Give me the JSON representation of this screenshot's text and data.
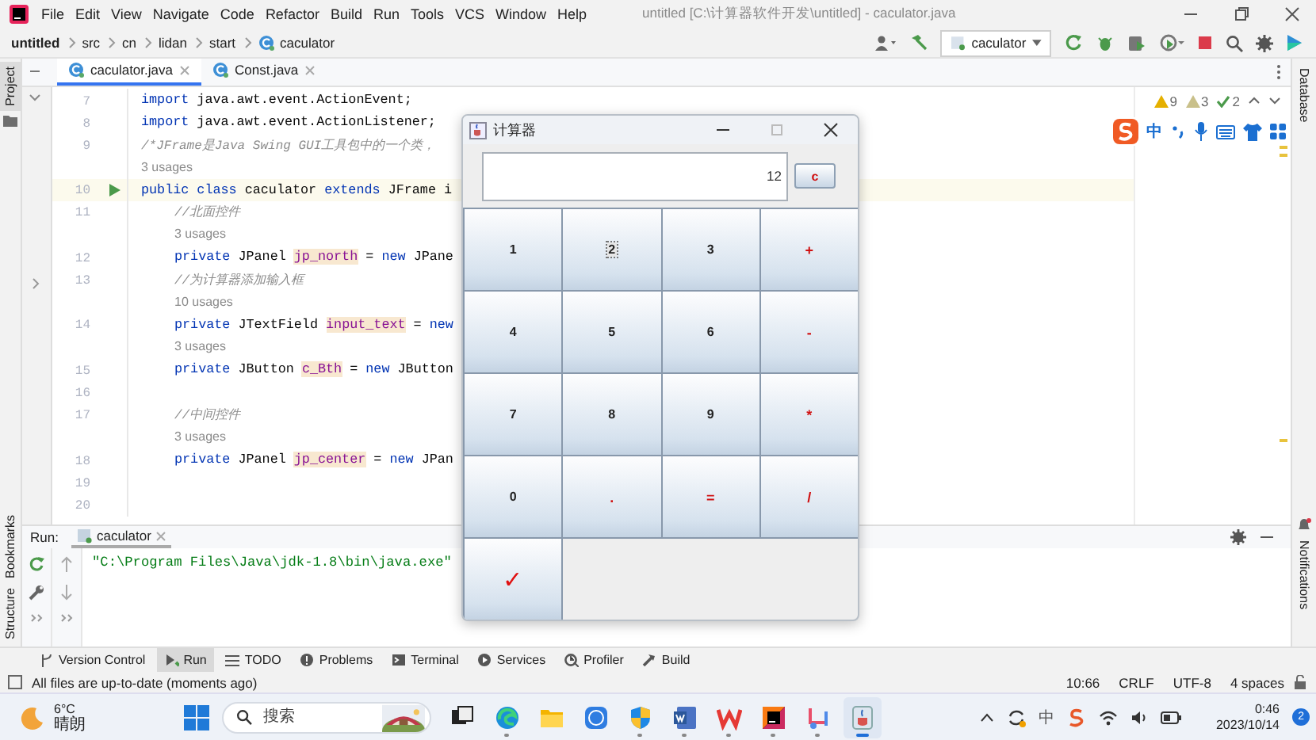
{
  "window": {
    "title": "untitled [C:\\计算器软件开发\\untitled] - caculator.java"
  },
  "menu": [
    "File",
    "Edit",
    "View",
    "Navigate",
    "Code",
    "Refactor",
    "Build",
    "Run",
    "Tools",
    "VCS",
    "Window",
    "Help"
  ],
  "breadcrumb": [
    "untitled",
    "src",
    "cn",
    "lidan",
    "start",
    "caculator"
  ],
  "run_config": "caculator",
  "side_left": {
    "top": "Project",
    "bottom": [
      "Bookmarks",
      "Structure"
    ]
  },
  "side_right": [
    "Database",
    "Notifications"
  ],
  "editor_tabs": [
    {
      "label": "caculator.java",
      "selected": true
    },
    {
      "label": "Const.java",
      "selected": false
    }
  ],
  "inspections": [
    {
      "kind": "warning",
      "count": "9"
    },
    {
      "kind": "weak",
      "count": "3"
    },
    {
      "kind": "typo",
      "count": "2"
    }
  ],
  "ime": {
    "mode": "中"
  },
  "code_lines": [
    {
      "number": "7",
      "segments": [
        {
          "kind": "kw",
          "text": "import"
        },
        {
          "kind": "plain",
          "text": " java.awt.event.ActionEvent;"
        }
      ]
    },
    {
      "number": "8",
      "segments": [
        {
          "kind": "kw",
          "text": "import"
        },
        {
          "kind": "plain",
          "text": " java.awt.event.ActionListener;"
        }
      ]
    },
    {
      "number": "9",
      "segments": [
        {
          "kind": "comment",
          "text": "/*JFrame是Java Swing GUI工具包中的一个类，"
        }
      ]
    },
    {
      "segments": [
        {
          "kind": "hint",
          "text": "3 usages"
        }
      ]
    },
    {
      "number": "10",
      "current": true,
      "runnable": true,
      "segments": [
        {
          "kind": "kw",
          "text": "public class "
        },
        {
          "kind": "plain",
          "text": "caculator "
        },
        {
          "kind": "kw",
          "text": "extends "
        },
        {
          "kind": "plain",
          "text": "JFrame i"
        }
      ]
    },
    {
      "number": "11",
      "indented": true,
      "segments": [
        {
          "kind": "comment",
          "text": "//北面控件"
        }
      ]
    },
    {
      "indented": true,
      "segments": [
        {
          "kind": "hint",
          "text": "3 usages"
        }
      ]
    },
    {
      "number": "12",
      "indented": true,
      "segments": [
        {
          "kind": "kw",
          "text": "private "
        },
        {
          "kind": "plain",
          "text": "JPanel "
        },
        {
          "kind": "field",
          "text": "jp_north"
        },
        {
          "kind": "plain",
          "text": " = "
        },
        {
          "kind": "kw",
          "text": "new "
        },
        {
          "kind": "plain",
          "text": "JPane"
        }
      ]
    },
    {
      "number": "13",
      "indented": true,
      "segments": [
        {
          "kind": "comment",
          "text": "//为计算器添加输入框"
        }
      ]
    },
    {
      "indented": true,
      "segments": [
        {
          "kind": "hint",
          "text": "10 usages"
        }
      ]
    },
    {
      "number": "14",
      "indented": true,
      "segments": [
        {
          "kind": "kw",
          "text": "private "
        },
        {
          "kind": "plain",
          "text": "JTextField "
        },
        {
          "kind": "field",
          "text": "input_text"
        },
        {
          "kind": "plain",
          "text": " = "
        },
        {
          "kind": "kw",
          "text": "new"
        }
      ]
    },
    {
      "indented": true,
      "segments": [
        {
          "kind": "hint",
          "text": "3 usages"
        }
      ]
    },
    {
      "number": "15",
      "indented": true,
      "segments": [
        {
          "kind": "kw",
          "text": "private "
        },
        {
          "kind": "plain",
          "text": "JButton "
        },
        {
          "kind": "field",
          "text": "c_Bth"
        },
        {
          "kind": "plain",
          "text": " = "
        },
        {
          "kind": "kw",
          "text": "new "
        },
        {
          "kind": "plain",
          "text": "JButton"
        }
      ]
    },
    {
      "number": "16"
    },
    {
      "number": "17",
      "indented": true,
      "segments": [
        {
          "kind": "comment",
          "text": "//中间控件"
        }
      ]
    },
    {
      "indented": true,
      "segments": [
        {
          "kind": "hint",
          "text": "3 usages"
        }
      ]
    },
    {
      "number": "18",
      "indented": true,
      "segments": [
        {
          "kind": "kw",
          "text": "private "
        },
        {
          "kind": "plain",
          "text": "JPanel "
        },
        {
          "kind": "field",
          "text": "jp_center"
        },
        {
          "kind": "plain",
          "text": " = "
        },
        {
          "kind": "kw",
          "text": "new "
        },
        {
          "kind": "plain",
          "text": "JPan"
        }
      ]
    },
    {
      "number": "19"
    },
    {
      "number": "20"
    }
  ],
  "calculator": {
    "title": "计算器",
    "display": "12",
    "clear": "c",
    "keys": [
      {
        "label": "1",
        "kind": "digit",
        "focused": false
      },
      {
        "label": "2",
        "kind": "digit",
        "focused": true
      },
      {
        "label": "3",
        "kind": "digit",
        "focused": false
      },
      {
        "label": "+",
        "kind": "op",
        "focused": false
      },
      {
        "label": "4",
        "kind": "digit",
        "focused": false
      },
      {
        "label": "5",
        "kind": "digit",
        "focused": false
      },
      {
        "label": "6",
        "kind": "digit",
        "focused": false
      },
      {
        "label": "-",
        "kind": "op",
        "focused": false
      },
      {
        "label": "7",
        "kind": "digit",
        "focused": false
      },
      {
        "label": "8",
        "kind": "digit",
        "focused": false
      },
      {
        "label": "9",
        "kind": "digit",
        "focused": false
      },
      {
        "label": "*",
        "kind": "op",
        "focused": false
      },
      {
        "label": "0",
        "kind": "digit",
        "focused": false
      },
      {
        "label": ".",
        "kind": "op",
        "focused": false
      },
      {
        "label": "=",
        "kind": "op",
        "focused": false
      },
      {
        "label": "/",
        "kind": "op",
        "focused": false
      },
      {
        "label": "✓",
        "kind": "check",
        "focused": false
      }
    ]
  },
  "run_panel": {
    "label": "Run:",
    "tab": "caculator",
    "output": "\"C:\\Program Files\\Java\\jdk-1.8\\bin\\java.exe\""
  },
  "tool_windows": [
    {
      "label": "Version Control",
      "selected": false
    },
    {
      "label": "Run",
      "selected": true
    },
    {
      "label": "TODO",
      "selected": false
    },
    {
      "label": "Problems",
      "selected": false
    },
    {
      "label": "Terminal",
      "selected": false
    },
    {
      "label": "Services",
      "selected": false
    },
    {
      "label": "Profiler",
      "selected": false
    },
    {
      "label": "Build",
      "selected": false
    }
  ],
  "status": {
    "message": "All files are up-to-date (moments ago)",
    "items": [
      "10:66",
      "CRLF",
      "UTF-8",
      "4 spaces"
    ]
  },
  "taskbar": {
    "temperature": "6°C",
    "weather": "晴朗",
    "search_placeholder": "搜索",
    "apps": [
      {
        "kind": "taskview",
        "running": false,
        "active": false
      },
      {
        "kind": "edge",
        "running": true,
        "active": false
      },
      {
        "kind": "files",
        "running": false,
        "active": false
      },
      {
        "kind": "k-app",
        "running": false,
        "active": false
      },
      {
        "kind": "shield",
        "running": true,
        "active": false
      },
      {
        "kind": "word",
        "running": true,
        "active": false
      },
      {
        "kind": "wps",
        "running": true,
        "active": false
      },
      {
        "kind": "ide",
        "running": true,
        "active": false
      },
      {
        "kind": "snip",
        "running": true,
        "active": false
      },
      {
        "kind": "java",
        "running": true,
        "active": true
      }
    ],
    "ime_mode": "中",
    "time": "0:46",
    "date": "2023/10/14",
    "badge": "2"
  }
}
